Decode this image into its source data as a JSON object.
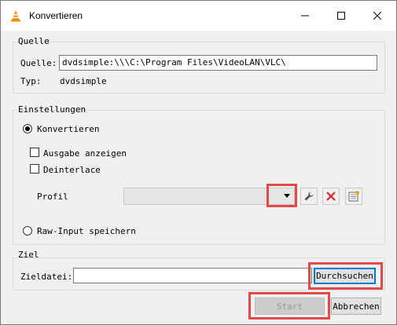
{
  "window": {
    "title": "Konvertieren"
  },
  "source": {
    "group_title": "Quelle",
    "source_label": "Quelle:",
    "source_value": "dvdsimple:\\\\\\C:\\Program Files\\VideoLAN\\VLC\\",
    "type_label": "Typ:",
    "type_value": "dvdsimple"
  },
  "settings": {
    "group_title": "Einstellungen",
    "convert_label": "Konvertieren",
    "show_output_label": "Ausgabe anzeigen",
    "deinterlace_label": "Deinterlace",
    "profile_label": "Profil",
    "raw_input_label": "Raw-Input speichern"
  },
  "target": {
    "group_title": "Ziel",
    "file_label": "Zieldatei:",
    "file_value": "",
    "browse_label": "Durchsuchen"
  },
  "buttons": {
    "start": "Start",
    "cancel": "Abbrechen"
  },
  "colors": {
    "highlight": "#e24a4a",
    "focus": "#0078d7",
    "delete_icon": "#d9262c"
  }
}
